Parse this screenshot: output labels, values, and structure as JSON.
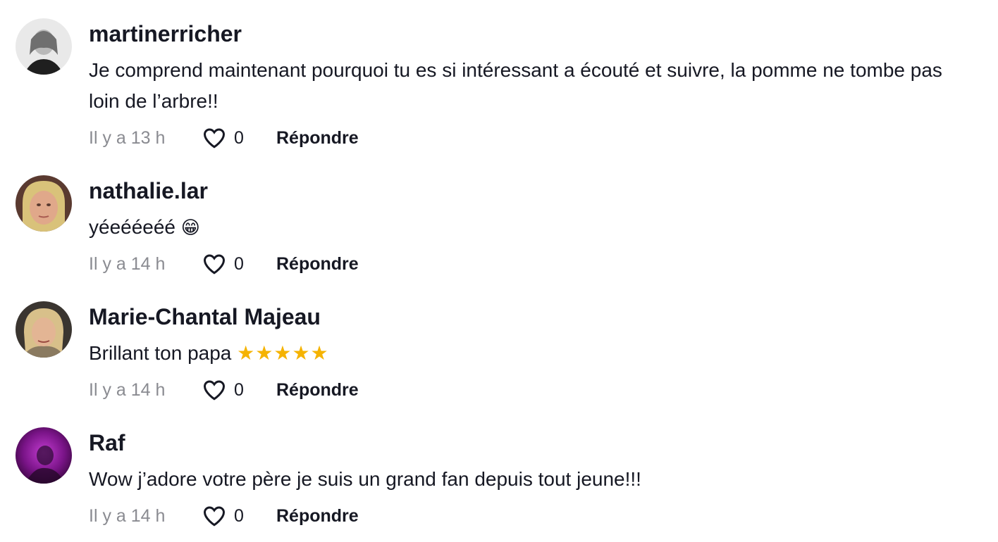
{
  "comments": [
    {
      "username": "martinerricher",
      "text": "Je comprend maintenant pourquoi tu es si intéressant a écouté et suivre, la pomme ne tombe pas loin de l’arbre!!",
      "emoji": "",
      "time": "Il y a 13 h",
      "likes": "0",
      "reply_label": "Répondre"
    },
    {
      "username": "nathalie.lar",
      "text": "yéeééeéé ",
      "emoji": "😁",
      "time": "Il y a 14 h",
      "likes": "0",
      "reply_label": "Répondre"
    },
    {
      "username": "Marie-Chantal Majeau",
      "text": "Brillant ton papa ",
      "emoji": "★★★★★",
      "time": "Il y a 14 h",
      "likes": "0",
      "reply_label": "Répondre"
    },
    {
      "username": "Raf",
      "text": "Wow j’adore votre père je suis un grand fan depuis tout jeune!!!",
      "emoji": "",
      "time": "Il y a 14 h",
      "likes": "0",
      "reply_label": "Répondre"
    }
  ],
  "icons": {
    "like": "heart-outline-icon"
  },
  "colors": {
    "text": "#161823",
    "muted": "#8a8b91",
    "star": "#f5b301"
  }
}
